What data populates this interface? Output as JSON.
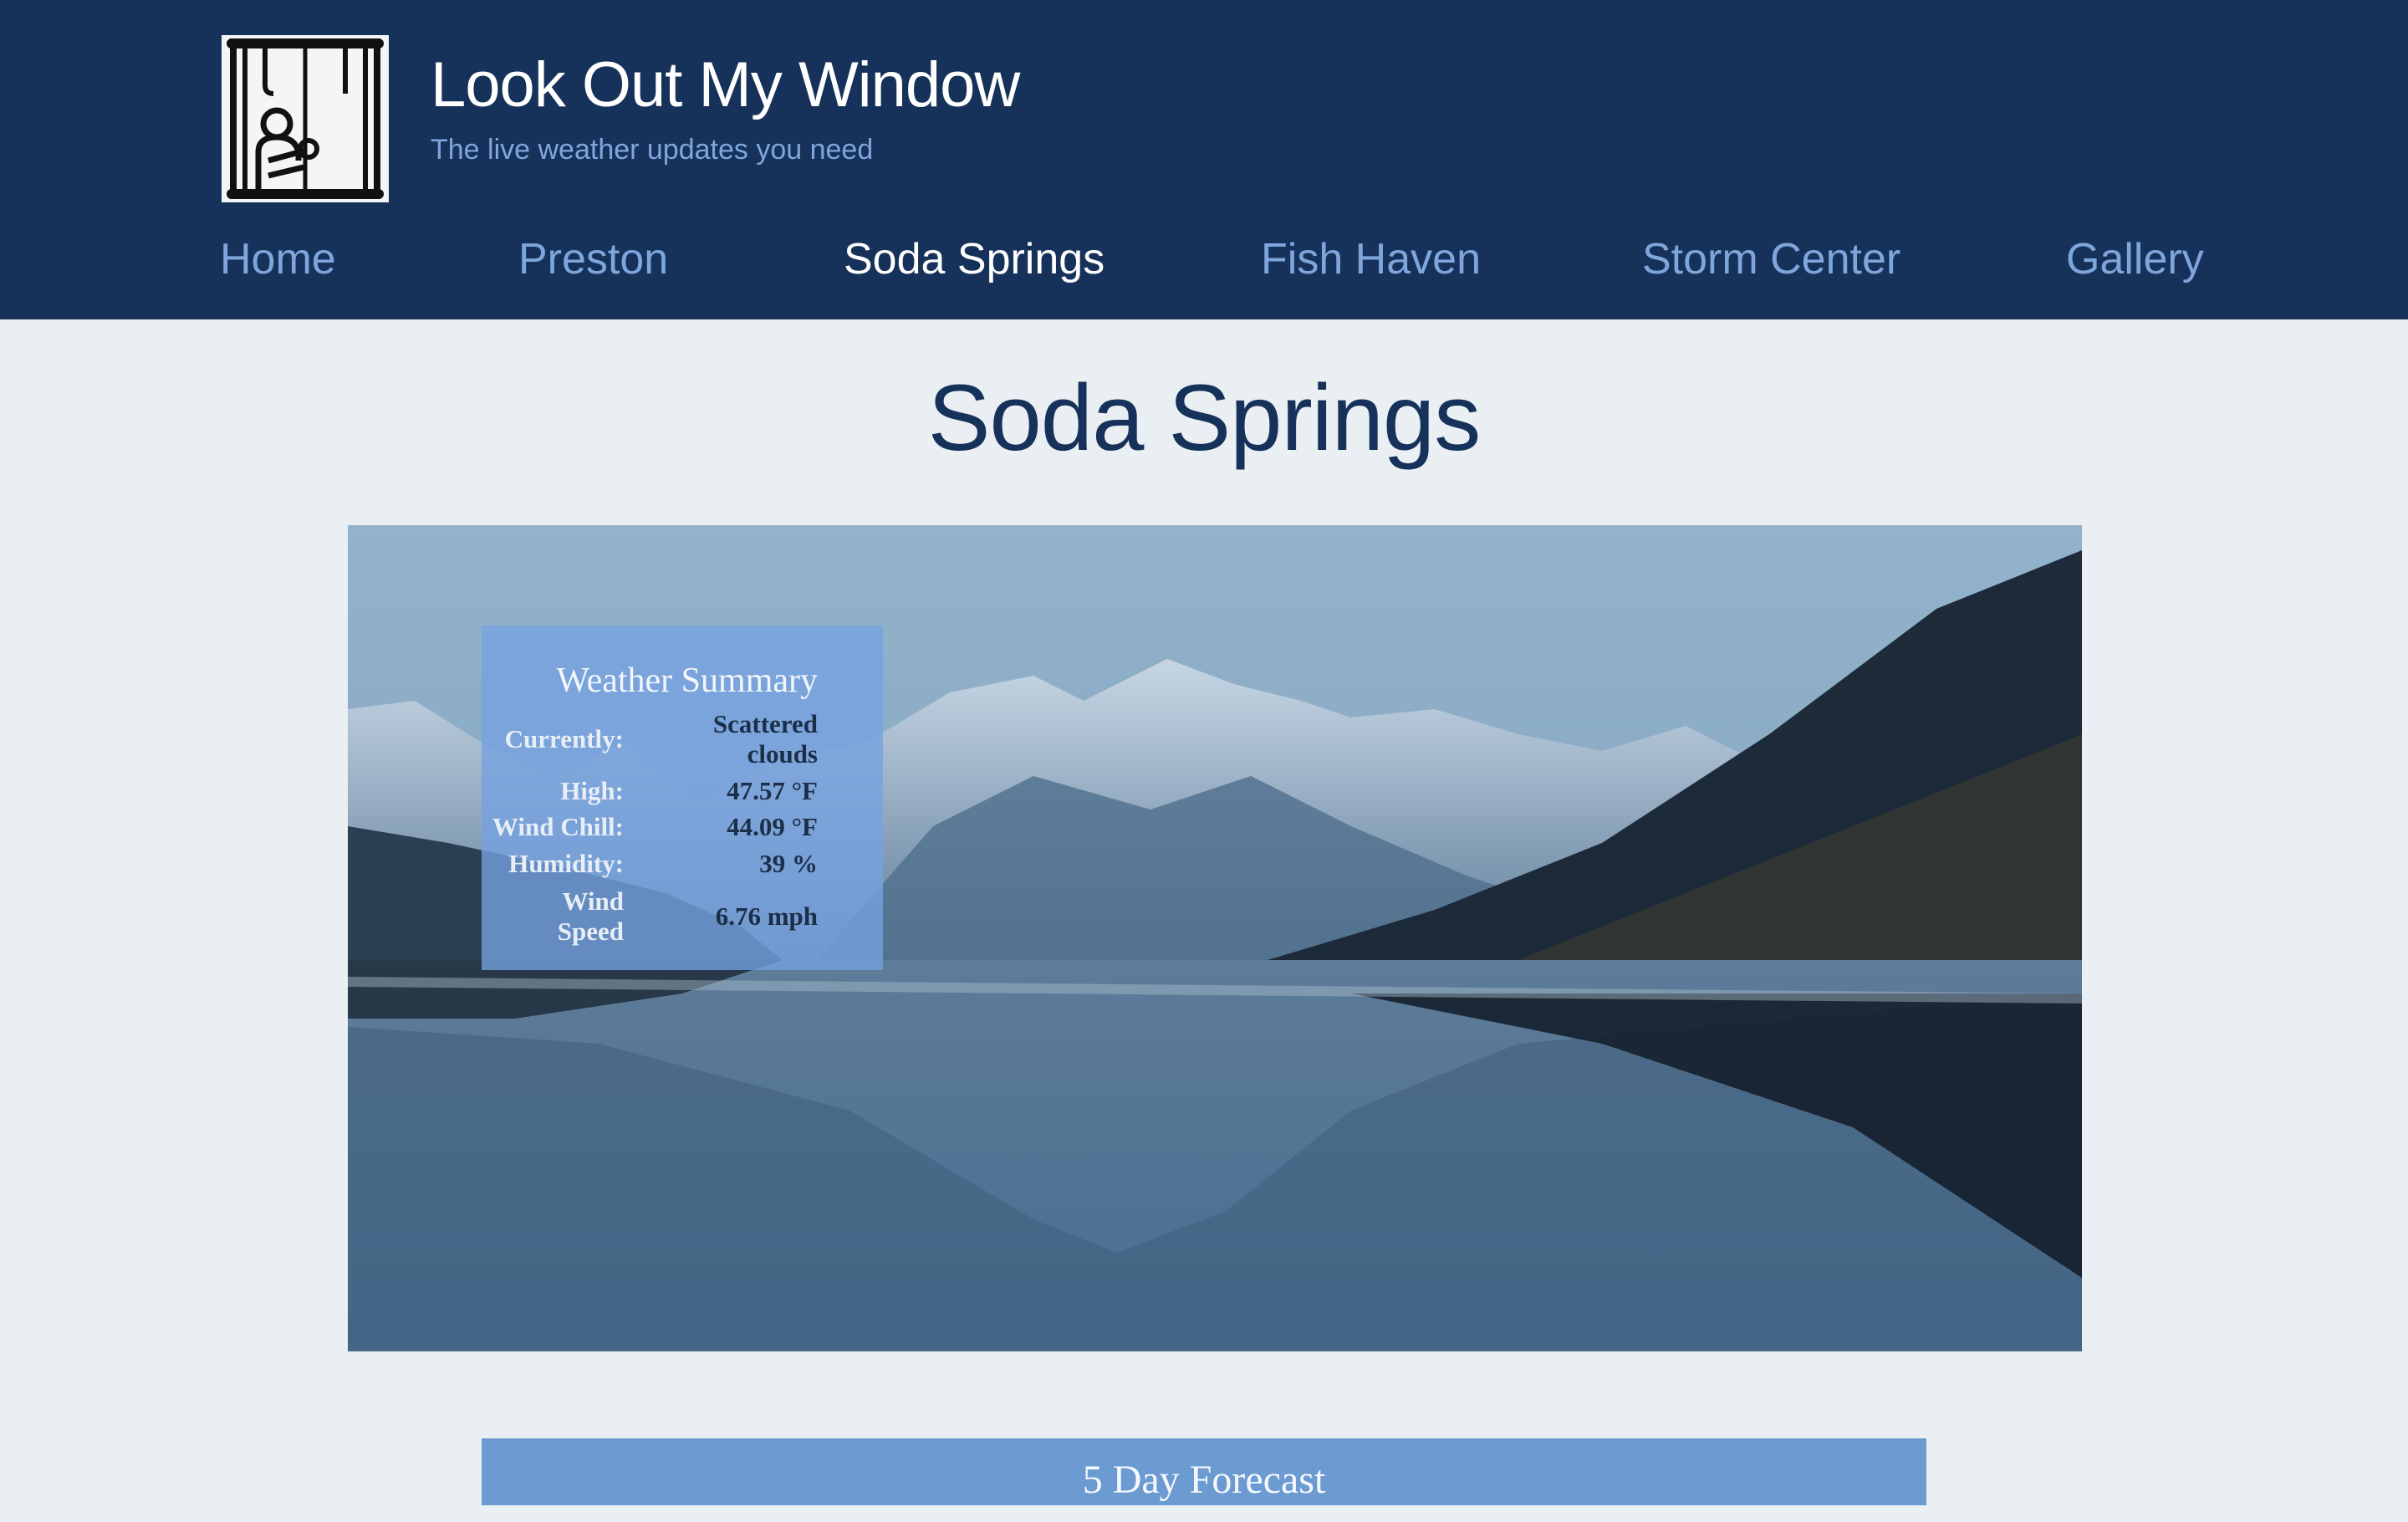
{
  "site": {
    "title": "Look Out My Window",
    "tagline": "The live weather updates you need",
    "logo_icon": "person-at-window-icon"
  },
  "nav": {
    "items": [
      {
        "label": "Home",
        "active": false
      },
      {
        "label": "Preston",
        "active": false
      },
      {
        "label": "Soda Springs",
        "active": true
      },
      {
        "label": "Fish Haven",
        "active": false
      },
      {
        "label": "Storm Center",
        "active": false
      },
      {
        "label": "Gallery",
        "active": false
      }
    ]
  },
  "page": {
    "title": "Soda Springs",
    "hero_image": "mountain-lake-reflection"
  },
  "weather_summary": {
    "title": "Weather Summary",
    "rows": [
      {
        "label": "Currently:",
        "value": "Scattered clouds"
      },
      {
        "label": "High:",
        "value": "47.57 °F"
      },
      {
        "label": "Wind Chill:",
        "value": "44.09 °F"
      },
      {
        "label": "Humidity:",
        "value": "39 %"
      },
      {
        "label": "Wind Speed",
        "value": "6.76 mph"
      }
    ]
  },
  "forecast": {
    "title": "5 Day Forecast"
  },
  "colors": {
    "header_bg": "#17325a",
    "nav_link": "#7fa6dc",
    "nav_active": "#ffffff",
    "page_bg": "#e9eff2",
    "summary_bg": "#74a2e0",
    "forecast_bg": "#6c9bd2"
  }
}
